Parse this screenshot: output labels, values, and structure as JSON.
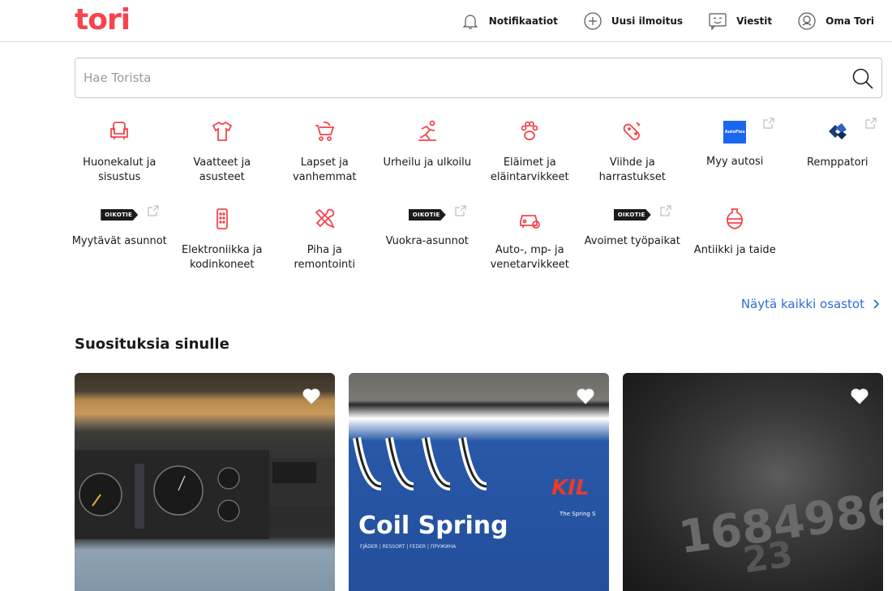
{
  "header": {
    "logo": "tori",
    "nav": [
      {
        "label": "Notifikaatiot",
        "icon": "bell-icon"
      },
      {
        "label": "Uusi ilmoitus",
        "icon": "plus-circle-icon"
      },
      {
        "label": "Viestit",
        "icon": "chat-icon"
      },
      {
        "label": "Oma Tori",
        "icon": "user-icon"
      }
    ]
  },
  "search": {
    "placeholder": "Hae Torista",
    "value": ""
  },
  "categories": {
    "row1": [
      {
        "label": "Huonekalut ja sisustus",
        "icon": "armchair-icon"
      },
      {
        "label": "Vaatteet ja asusteet",
        "icon": "shirt-icon"
      },
      {
        "label": "Lapset ja vanhemmat",
        "icon": "stroller-icon"
      },
      {
        "label": "Urheilu ja ulkoilu",
        "icon": "runner-icon"
      },
      {
        "label": "Eläimet ja eläintarvikkeet",
        "icon": "paw-icon"
      },
      {
        "label": "Viihde ja harrastukset",
        "icon": "gamepad-icon"
      },
      {
        "label": "Myy autosi",
        "icon": "autoflex-logo",
        "logo_text": "AutoFlex"
      },
      {
        "label": "Remppatori",
        "icon": "remppatori-logo"
      }
    ],
    "row2": [
      {
        "label": "Myytävät asunnot",
        "icon": "oikotie-logo",
        "logo_text": "OIKOTIE"
      },
      {
        "label": "Elektroniikka ja kodinkoneet",
        "icon": "remote-icon"
      },
      {
        "label": "Piha ja remontointi",
        "icon": "tools-icon"
      },
      {
        "label": "Vuokra-asunnot",
        "icon": "oikotie-logo",
        "logo_text": "OIKOTIE"
      },
      {
        "label": "Auto-, mp- ja venetarvikkeet",
        "icon": "car-gear-icon"
      },
      {
        "label": "Avoimet työpaikat",
        "icon": "oikotie-logo",
        "logo_text": "OIKOTIE"
      },
      {
        "label": "Antiikki ja taide",
        "icon": "vase-icon"
      }
    ]
  },
  "show_all": "Näytä kaikki osastot",
  "section_title": "Suosituksia sinulle",
  "colors": {
    "brand": "#f5444d",
    "link": "#2f6bd8"
  }
}
